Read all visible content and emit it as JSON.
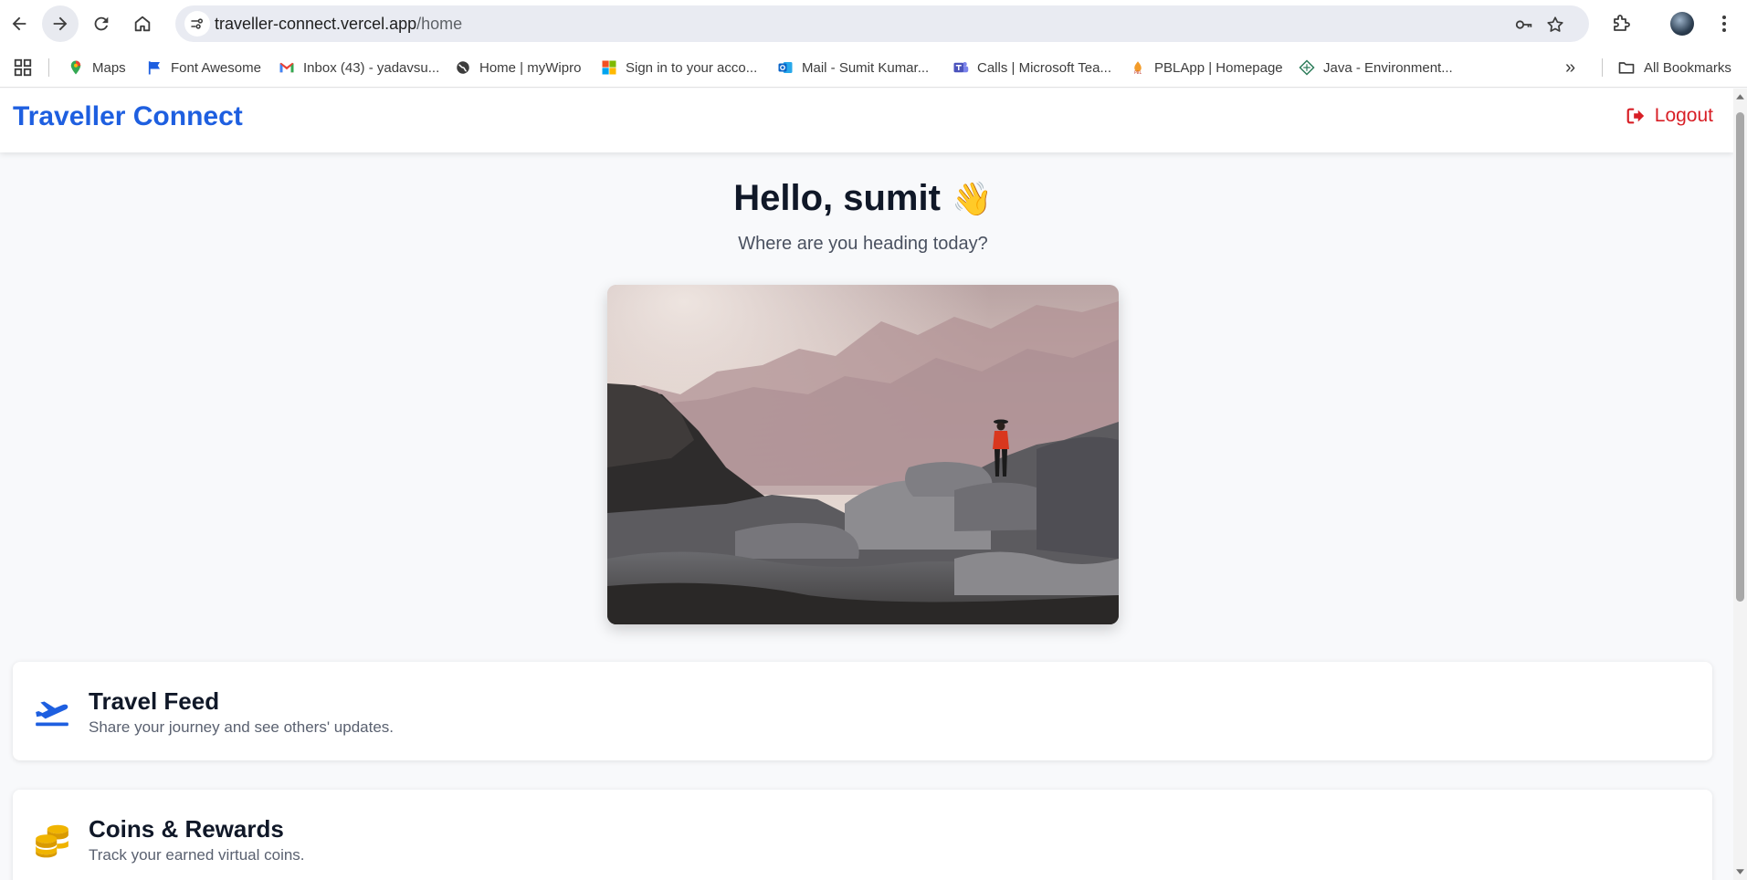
{
  "browser": {
    "url_host": "traveller-connect.vercel.app",
    "url_path": "/home",
    "bookmarks": [
      {
        "label": "Maps"
      },
      {
        "label": "Font Awesome"
      },
      {
        "label": "Inbox (43) - yadavsu..."
      },
      {
        "label": "Home | myWipro"
      },
      {
        "label": "Sign in to your acco..."
      },
      {
        "label": "Mail - Sumit Kumar..."
      },
      {
        "label": "Calls | Microsoft Tea..."
      },
      {
        "label": "PBLApp | Homepage"
      },
      {
        "label": "Java - Environment..."
      }
    ],
    "all_bookmarks_label": "All Bookmarks",
    "overflow_label": "»"
  },
  "header": {
    "brand": "Traveller Connect",
    "logout_label": "Logout"
  },
  "hero": {
    "greeting": "Hello, sumit",
    "wave": "👋",
    "subtitle": "Where are you heading today?"
  },
  "cards": [
    {
      "title": "Travel Feed",
      "description": "Share your journey and see others' updates.",
      "icon": "plane-departure-icon"
    },
    {
      "title": "Coins & Rewards",
      "description": "Track your earned virtual coins.",
      "icon": "coins-icon"
    }
  ],
  "colors": {
    "brand": "#1e5fe0",
    "logout": "#d81f26",
    "coins": "#f0b400"
  }
}
